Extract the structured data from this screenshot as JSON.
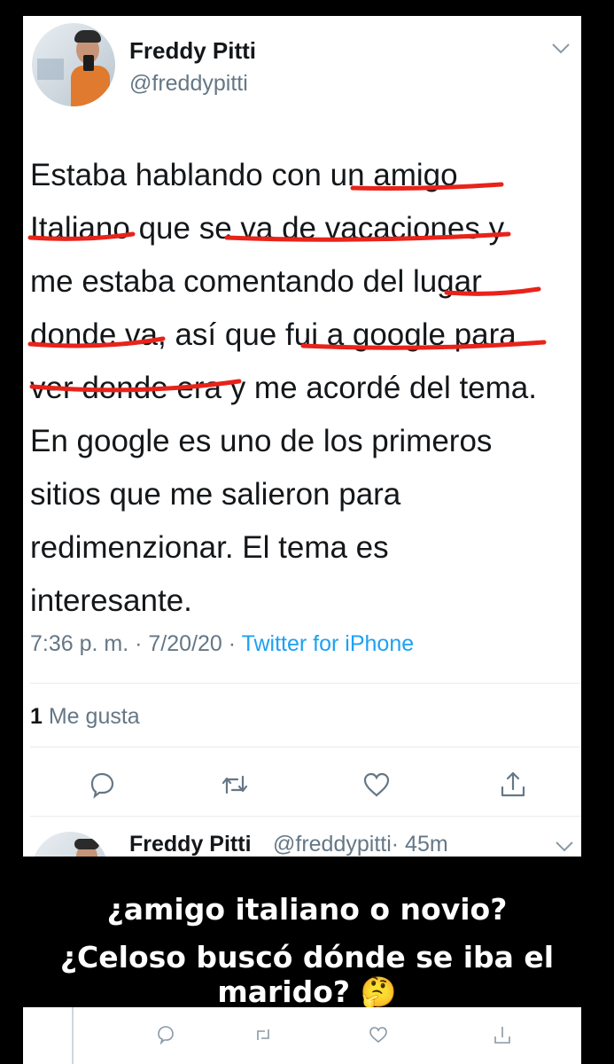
{
  "author": {
    "name": "Freddy Pitti",
    "handle": "@freddypitti"
  },
  "tweet": {
    "lines": [
      "Estaba hablando con un amigo",
      "Italiano que se va de vacaciones y",
      "me estaba comentando del lugar",
      "donde va, así que fui a google para",
      "ver donde era y me acordé del tema.",
      "En google es uno de los primeros",
      "sitios que me salieron para",
      "redimenzionar. El tema es",
      "interesante."
    ],
    "time": "7:36 p. m.",
    "date": "7/20/20",
    "separator": "·",
    "source": "Twitter for iPhone",
    "likes_count": "1",
    "likes_label": "Me gusta",
    "underline_color": "#e8231a"
  },
  "reply": {
    "name": "Freddy Pitti",
    "handle": "@freddypitti",
    "time": "· 45m"
  },
  "caption": {
    "line1": "¿amigo italiano o novio?",
    "line2": "¿Celoso buscó dónde se iba el marido? 🤔"
  },
  "icons": [
    "reply-icon",
    "retweet-icon",
    "like-icon",
    "share-icon",
    "chevron-down-icon"
  ]
}
